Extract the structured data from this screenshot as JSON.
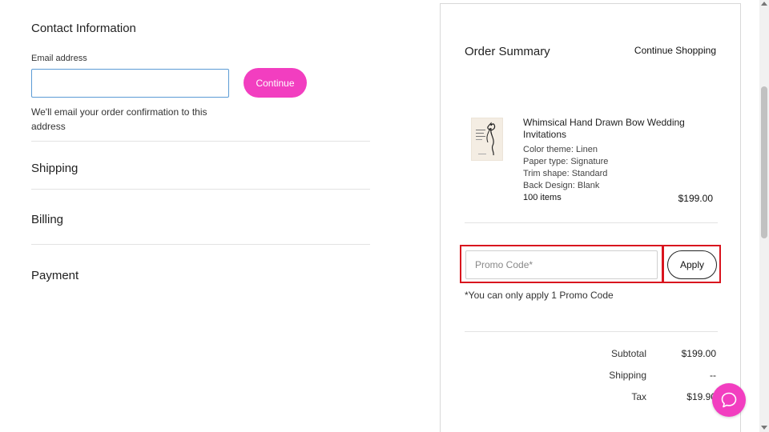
{
  "contact": {
    "title": "Contact Information",
    "email_label": "Email address",
    "email_value": "",
    "continue_label": "Continue",
    "note": "We'll email your order confirmation to this address"
  },
  "sections": {
    "shipping": "Shipping",
    "billing": "Billing",
    "payment": "Payment"
  },
  "summary": {
    "title": "Order Summary",
    "continue_shopping": "Continue Shopping",
    "product": {
      "name": "Whimsical Hand Drawn Bow Wedding Invitations",
      "options": [
        "Color theme: Linen",
        "Paper type: Signature",
        "Trim shape: Standard",
        "Back Design: Blank"
      ],
      "quantity": "100 items",
      "price": "$199.00"
    },
    "promo": {
      "placeholder": "Promo Code*",
      "apply_label": "Apply",
      "note": "*You can only apply 1 Promo Code"
    },
    "totals": [
      {
        "label": "Subtotal",
        "value": "$199.00"
      },
      {
        "label": "Shipping",
        "value": "--"
      },
      {
        "label": "Tax",
        "value": "$19.90"
      }
    ]
  },
  "colors": {
    "accent_pink": "#f23ec0",
    "highlight_red": "#d9141e",
    "input_focus_blue": "#5b9bd5"
  },
  "icons": {
    "chat": "chat-bubble-icon"
  }
}
